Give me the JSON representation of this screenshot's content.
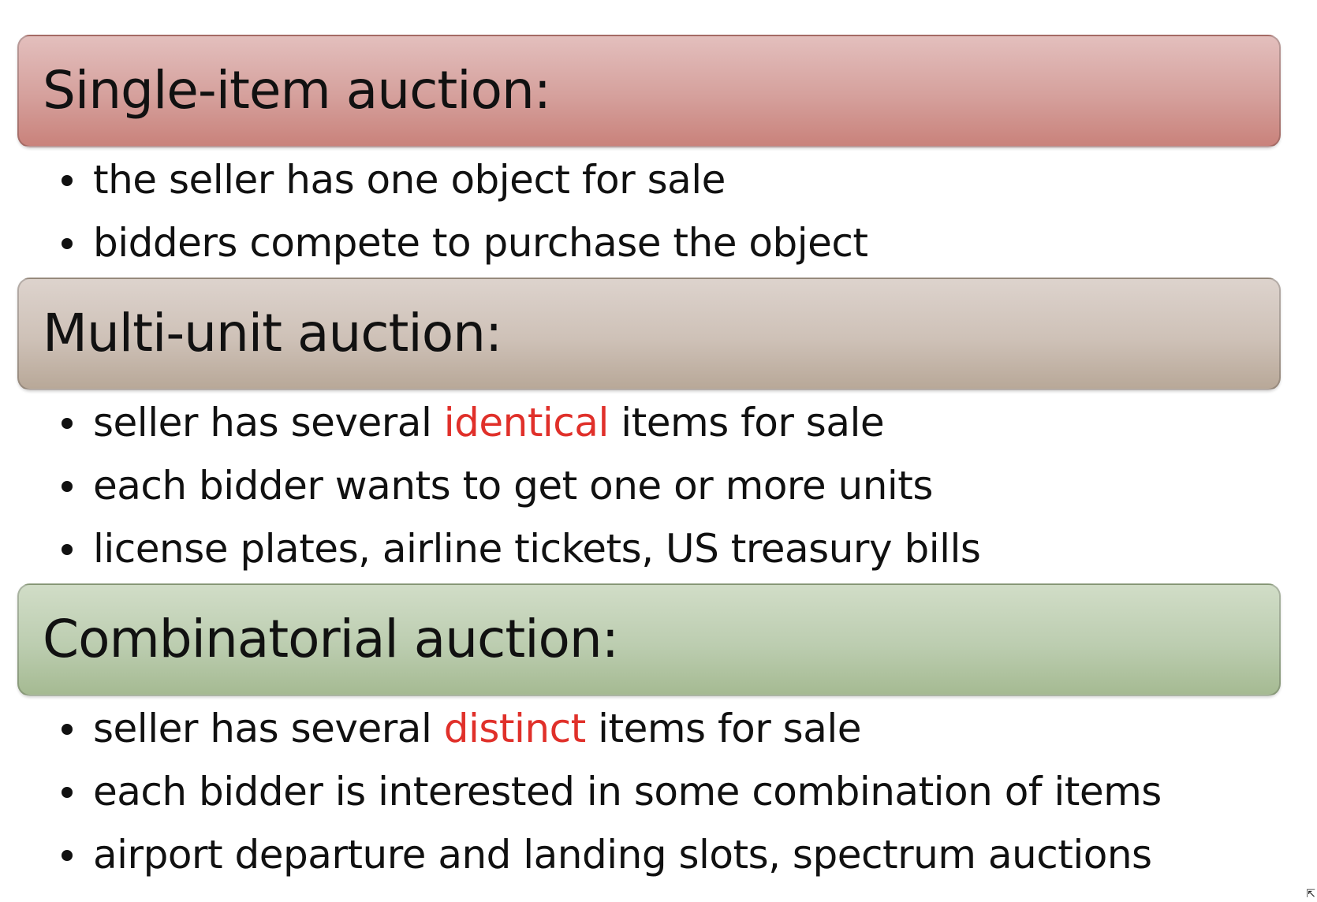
{
  "sections": [
    {
      "title": "Single-item auction:",
      "bullets": [
        {
          "before": "the seller has one object for sale",
          "highlight": "",
          "after": ""
        },
        {
          "before": "bidders compete to purchase the object",
          "highlight": "",
          "after": ""
        }
      ]
    },
    {
      "title": "Multi-unit auction:",
      "bullets": [
        {
          "before": "seller has several ",
          "highlight": "identical",
          "after": " items for sale"
        },
        {
          "before": "each bidder wants to get one or more units",
          "highlight": "",
          "after": ""
        },
        {
          "before": "license plates, airline tickets, US treasury bills",
          "highlight": "",
          "after": ""
        }
      ]
    },
    {
      "title": "Combinatorial auction:",
      "bullets": [
        {
          "before": "seller has several ",
          "highlight": "distinct",
          "after": " items for sale"
        },
        {
          "before": "each bidder is interested in some combination of items",
          "highlight": "",
          "after": ""
        },
        {
          "before": "airport departure and landing slots, spectrum auctions",
          "highlight": "",
          "after": ""
        }
      ]
    }
  ],
  "colors": {
    "highlight": "#e0302a",
    "header_red": "#d5a09c",
    "header_tan": "#cec1b7",
    "header_green": "#bccdb0"
  },
  "corner_icon": "resize-arrow-icon"
}
